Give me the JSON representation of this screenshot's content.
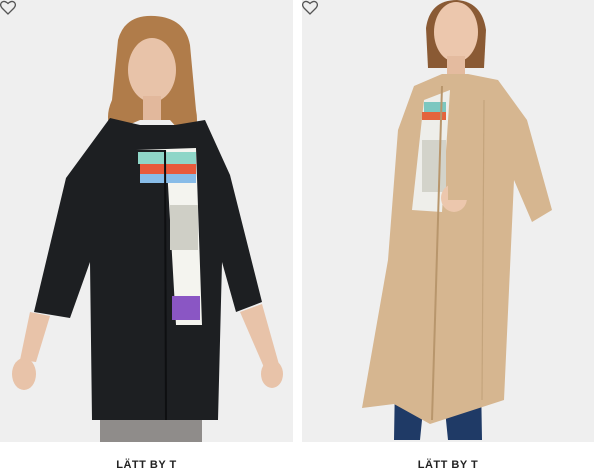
{
  "products": [
    {
      "brand": "LÄTT BY T",
      "wishlist_icon": "heart-outline-icon",
      "coat_color": "#1d1f22"
    },
    {
      "brand": "LÄTT BY T",
      "wishlist_icon": "heart-outline-icon",
      "coat_color": "#d6b690"
    }
  ],
  "colors": {
    "background": "#efefef",
    "text": "#222222"
  }
}
